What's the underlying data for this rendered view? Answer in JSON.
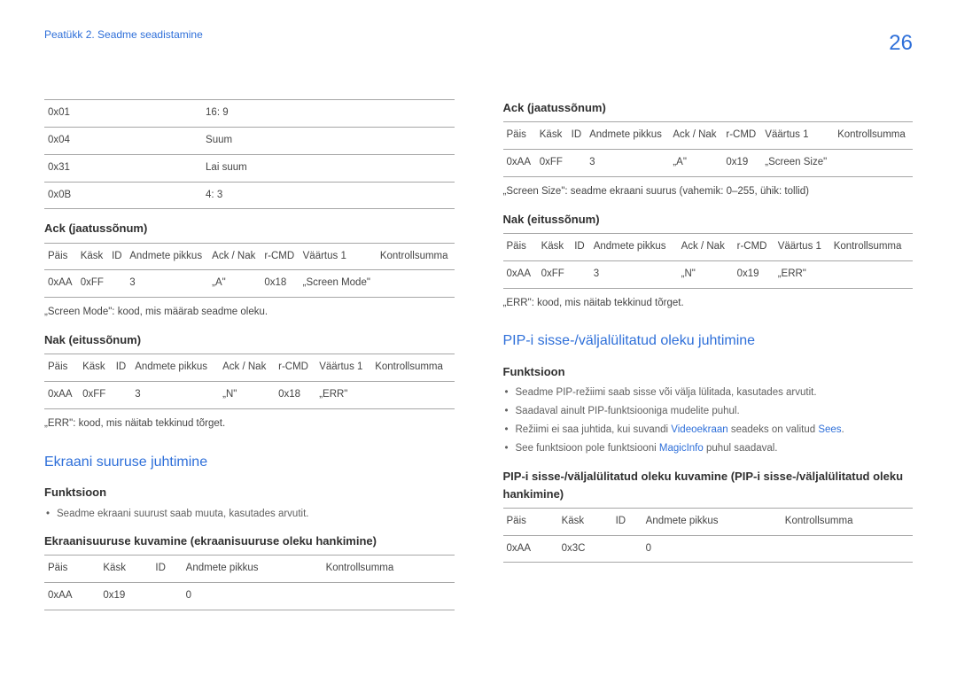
{
  "breadcrumb": "Peatükk 2. Seadme seadistamine",
  "page_number": "26",
  "left": {
    "topTable": {
      "rows": [
        [
          "0x01",
          "16: 9"
        ],
        [
          "0x04",
          "Suum"
        ],
        [
          "0x31",
          "Lai suum"
        ],
        [
          "0x0B",
          "4: 3"
        ]
      ]
    },
    "ack_h": "Ack (jaatussõnum)",
    "ackTable": {
      "head": [
        "Päis",
        "Käsk",
        "ID",
        "Andmete pikkus",
        "Ack / Nak",
        "r-CMD",
        "Väärtus 1",
        "Kontrollsumma"
      ],
      "row": [
        "0xAA",
        "0xFF",
        "",
        "3",
        "„A\"",
        "0x18",
        "„Screen Mode\"",
        ""
      ]
    },
    "ack_note": "„Screen Mode\": kood, mis määrab seadme oleku.",
    "nak_h": "Nak (eitussõnum)",
    "nakTable": {
      "head": [
        "Päis",
        "Käsk",
        "ID",
        "Andmete pikkus",
        "Ack / Nak",
        "r-CMD",
        "Väärtus 1",
        "Kontrollsumma"
      ],
      "row": [
        "0xAA",
        "0xFF",
        "",
        "3",
        "„N\"",
        "0x18",
        "„ERR\"",
        ""
      ]
    },
    "nak_note": "„ERR\": kood, mis näitab tekkinud tõrget.",
    "sec2_h": "Ekraani suuruse juhtimine",
    "func_h": "Funktsioon",
    "func_b1": "Seadme ekraani suurust saab muuta, kasutades arvutit.",
    "sub2_h": "Ekraanisuuruse kuvamine (ekraanisuuruse oleku hankimine)",
    "t2": {
      "head": [
        "Päis",
        "Käsk",
        "ID",
        "Andmete pikkus",
        "Kontrollsumma"
      ],
      "row": [
        "0xAA",
        "0x19",
        "",
        "0",
        ""
      ]
    }
  },
  "right": {
    "ack_h": "Ack (jaatussõnum)",
    "ackTable": {
      "head": [
        "Päis",
        "Käsk",
        "ID",
        "Andmete pikkus",
        "Ack / Nak",
        "r-CMD",
        "Väärtus 1",
        "Kontrollsumma"
      ],
      "row": [
        "0xAA",
        "0xFF",
        "",
        "3",
        "„A\"",
        "0x19",
        "„Screen Size\"",
        ""
      ]
    },
    "ack_note": "„Screen Size\": seadme ekraani suurus (vahemik: 0–255, ühik: tollid)",
    "nak_h": "Nak (eitussõnum)",
    "nakTable": {
      "head": [
        "Päis",
        "Käsk",
        "ID",
        "Andmete pikkus",
        "Ack / Nak",
        "r-CMD",
        "Väärtus 1",
        "Kontrollsumma"
      ],
      "row": [
        "0xAA",
        "0xFF",
        "",
        "3",
        "„N\"",
        "0x19",
        "„ERR\"",
        ""
      ]
    },
    "nak_note": "„ERR\": kood, mis näitab tekkinud tõrget.",
    "sec_h": "PIP-i sisse-/väljalülitatud oleku juhtimine",
    "func_h": "Funktsioon",
    "b1": "Seadme PIP-režiimi saab sisse või välja lülitada, kasutades arvutit.",
    "b2": "Saadaval ainult PIP-funktsiooniga mudelite puhul.",
    "b3a": "Režiimi ei saa juhtida, kui suvandi ",
    "b3hl1": "Videoekraan",
    "b3b": " seadeks on valitud ",
    "b3hl2": "Sees",
    "b3c": ".",
    "b4a": "See funktsioon pole funktsiooni ",
    "b4hl": "MagicInfo",
    "b4b": " puhul saadaval.",
    "sub_h": "PIP-i sisse-/väljalülitatud oleku kuvamine (PIP-i sisse-/väljalülitatud oleku hankimine)",
    "t2": {
      "head": [
        "Päis",
        "Käsk",
        "ID",
        "Andmete pikkus",
        "Kontrollsumma"
      ],
      "row": [
        "0xAA",
        "0x3C",
        "",
        "0",
        ""
      ]
    }
  }
}
